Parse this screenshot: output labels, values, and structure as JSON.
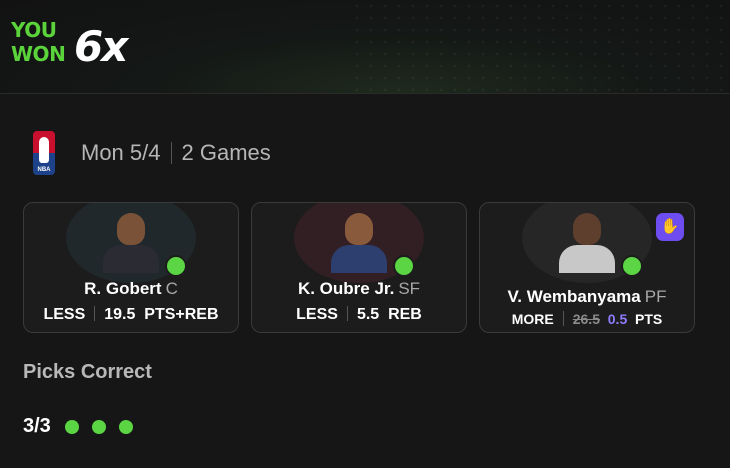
{
  "banner": {
    "line1": "YOU",
    "line2": "WON",
    "multiplier": "6x"
  },
  "slate": {
    "league_icon": "nba-logo-icon",
    "league_text": "NBA",
    "date": "Mon 5/4",
    "games": "2 Games"
  },
  "cards": [
    {
      "name": "R. Gobert",
      "position": "C",
      "direction": "LESS",
      "line": "19.5",
      "stat": "PTS+REB",
      "result_icon": "check-circle-icon"
    },
    {
      "name": "K. Oubre Jr.",
      "position": "SF",
      "direction": "LESS",
      "line": "5.5",
      "stat": "REB",
      "result_icon": "check-circle-icon"
    },
    {
      "name": "V. Wembanyama",
      "position": "PF",
      "direction": "MORE",
      "old_line": "26.5",
      "line": "0.5",
      "stat": "PTS",
      "result_icon": "check-circle-icon",
      "badge_icon": "boost-hand-icon"
    }
  ],
  "picks": {
    "title": "Picks Correct",
    "count": "3/3",
    "dots": 3
  },
  "colors": {
    "accent_green": "#5bd543",
    "boost_purple": "#6d4df0",
    "line_purple": "#8d7cff"
  }
}
